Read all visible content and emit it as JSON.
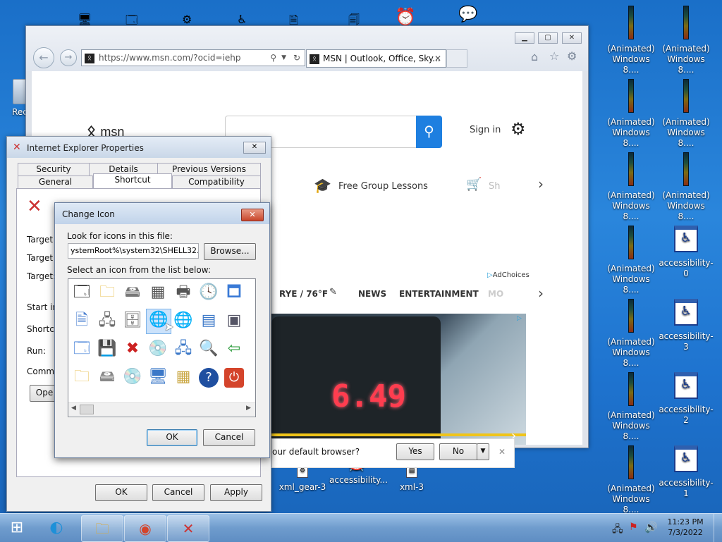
{
  "desktop": {
    "top_strip_labels": [],
    "left_icon": "Recy",
    "right_icons": [
      {
        "label": "(Animated)\nWindows 8....",
        "icon": "meter-icon"
      },
      {
        "label": "(Animated)\nWindows 8....",
        "icon": "meter-icon"
      },
      {
        "label": "(Animated)\nWindows 8....",
        "icon": "meter-icon"
      },
      {
        "label": "(Animated)\nWindows 8....",
        "icon": "meter-icon"
      },
      {
        "label": "(Animated)\nWindows 8....",
        "icon": "meter-icon"
      },
      {
        "label": "(Animated)\nWindows 8....",
        "icon": "meter-icon"
      },
      {
        "label": "accessibility-0",
        "icon": "accessibility-icon"
      },
      {
        "label": "(Animated)\nWindows 8....",
        "icon": "meter-icon"
      },
      {
        "label": "accessibility-3",
        "icon": "accessibility-icon"
      },
      {
        "label": "(Animated)\nWindows 8....",
        "icon": "meter-icon"
      },
      {
        "label": "accessibility-2",
        "icon": "accessibility-icon"
      },
      {
        "label": "(Animated)\nWindows 8....",
        "icon": "meter-icon"
      },
      {
        "label": "accessibility-1",
        "icon": "accessibility-icon"
      }
    ],
    "bottom_icons": [
      "xml_gear-3",
      "accessibility...",
      "xml-3"
    ]
  },
  "ie": {
    "url": "https://www.msn.com/?ocid=iehp",
    "tab_title": "MSN | Outlook, Office, Sky...",
    "msn_logo": "msn",
    "sign_in": "Sign in",
    "promo": "Free Group Lessons",
    "promo_cut": "Sh",
    "weather": "RYE / 76°F",
    "nav": [
      "NEWS",
      "ENTERTAINMENT",
      "MO"
    ],
    "adchoices": "AdChoices",
    "default_browser_q": "our default browser?",
    "yes": "Yes",
    "no": "No",
    "image_text": "6.49"
  },
  "props": {
    "title": "Internet Explorer Properties",
    "tabs_top": [
      "Security",
      "Details",
      "Previous Versions"
    ],
    "tabs_bottom": [
      "General",
      "Shortcut",
      "Compatibility"
    ],
    "labels": [
      "Target ty",
      "Target lo",
      "Target:",
      "Start in:",
      "Shortcut",
      "Run:",
      "Comme"
    ],
    "open_btn": "Ope",
    "ok": "OK",
    "cancel": "Cancel",
    "apply": "Apply"
  },
  "change_icon": {
    "title": "Change Icon",
    "look_label": "Look for icons in this file:",
    "file_path": "ystemRoot%\\system32\\SHELL32.dll",
    "browse": "Browse...",
    "select_label": "Select an icon from the list below:",
    "ok": "OK",
    "cancel": "Cancel"
  },
  "taskbar": {
    "time": "11:23 PM",
    "date": "7/3/2022"
  }
}
